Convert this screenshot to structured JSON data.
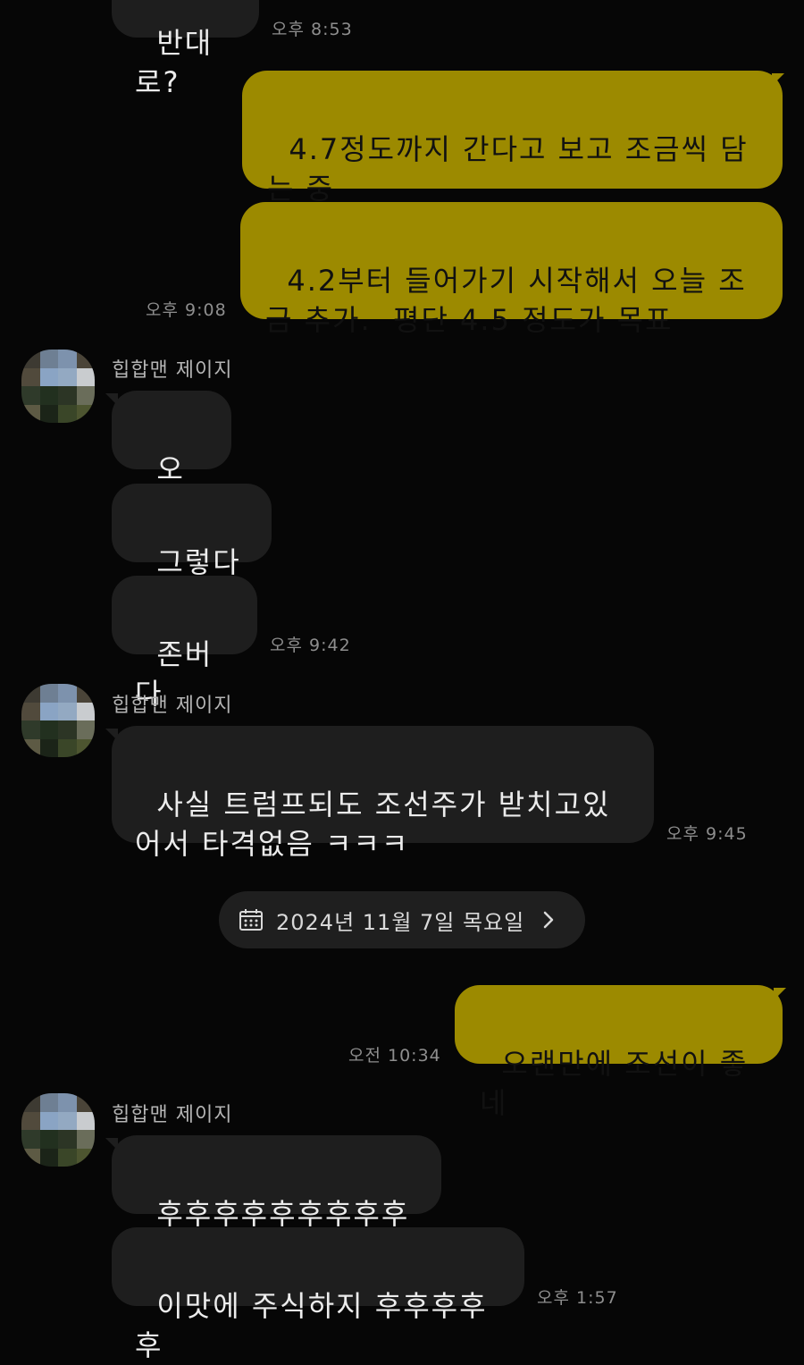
{
  "theme": {
    "background": "#060606",
    "incoming_bubble": "#1e1e1e",
    "outgoing_bubble": "#9c8a00"
  },
  "chat": {
    "sender_name": "힙합맨 제이지",
    "date_divider": "2024년 11월 7일 목요일",
    "messages": [
      {
        "id": "m0",
        "from": "other",
        "text": "반대로?",
        "time": "오후 8:53"
      },
      {
        "id": "m1",
        "from": "me",
        "text": "4.7정도까지 간다고 보고 조금씩 담는 중",
        "time": ""
      },
      {
        "id": "m2",
        "from": "me",
        "text": "4.2부터 들어가기 시작해서 오늘 조금 추가.  평단 4.5 정도가 목표",
        "time": "오후 9:08"
      },
      {
        "id": "m3",
        "from": "other",
        "text": "오호?",
        "time": ""
      },
      {
        "id": "m4",
        "from": "other",
        "text": "그렇다면",
        "time": ""
      },
      {
        "id": "m5",
        "from": "other",
        "text": "존버다",
        "time": "오후 9:42"
      },
      {
        "id": "m6",
        "from": "other",
        "text": "사실 트럼프되도 조선주가 받치고있어서 타격없음 ㅋㅋㅋ",
        "time": "오후 9:45"
      },
      {
        "id": "m7",
        "from": "me",
        "text": "오랜만에 조선이 좋네",
        "time": "오전 10:34"
      },
      {
        "id": "m8",
        "from": "other",
        "text": "후후후후후후후후후후",
        "time": ""
      },
      {
        "id": "m9",
        "from": "other",
        "text": "이맛에 주식하지 후후후후후",
        "time": "오후 1:57"
      }
    ]
  },
  "icons": {
    "date_icon": "calendar-icon",
    "date_arrow": "chevron-right-icon"
  }
}
